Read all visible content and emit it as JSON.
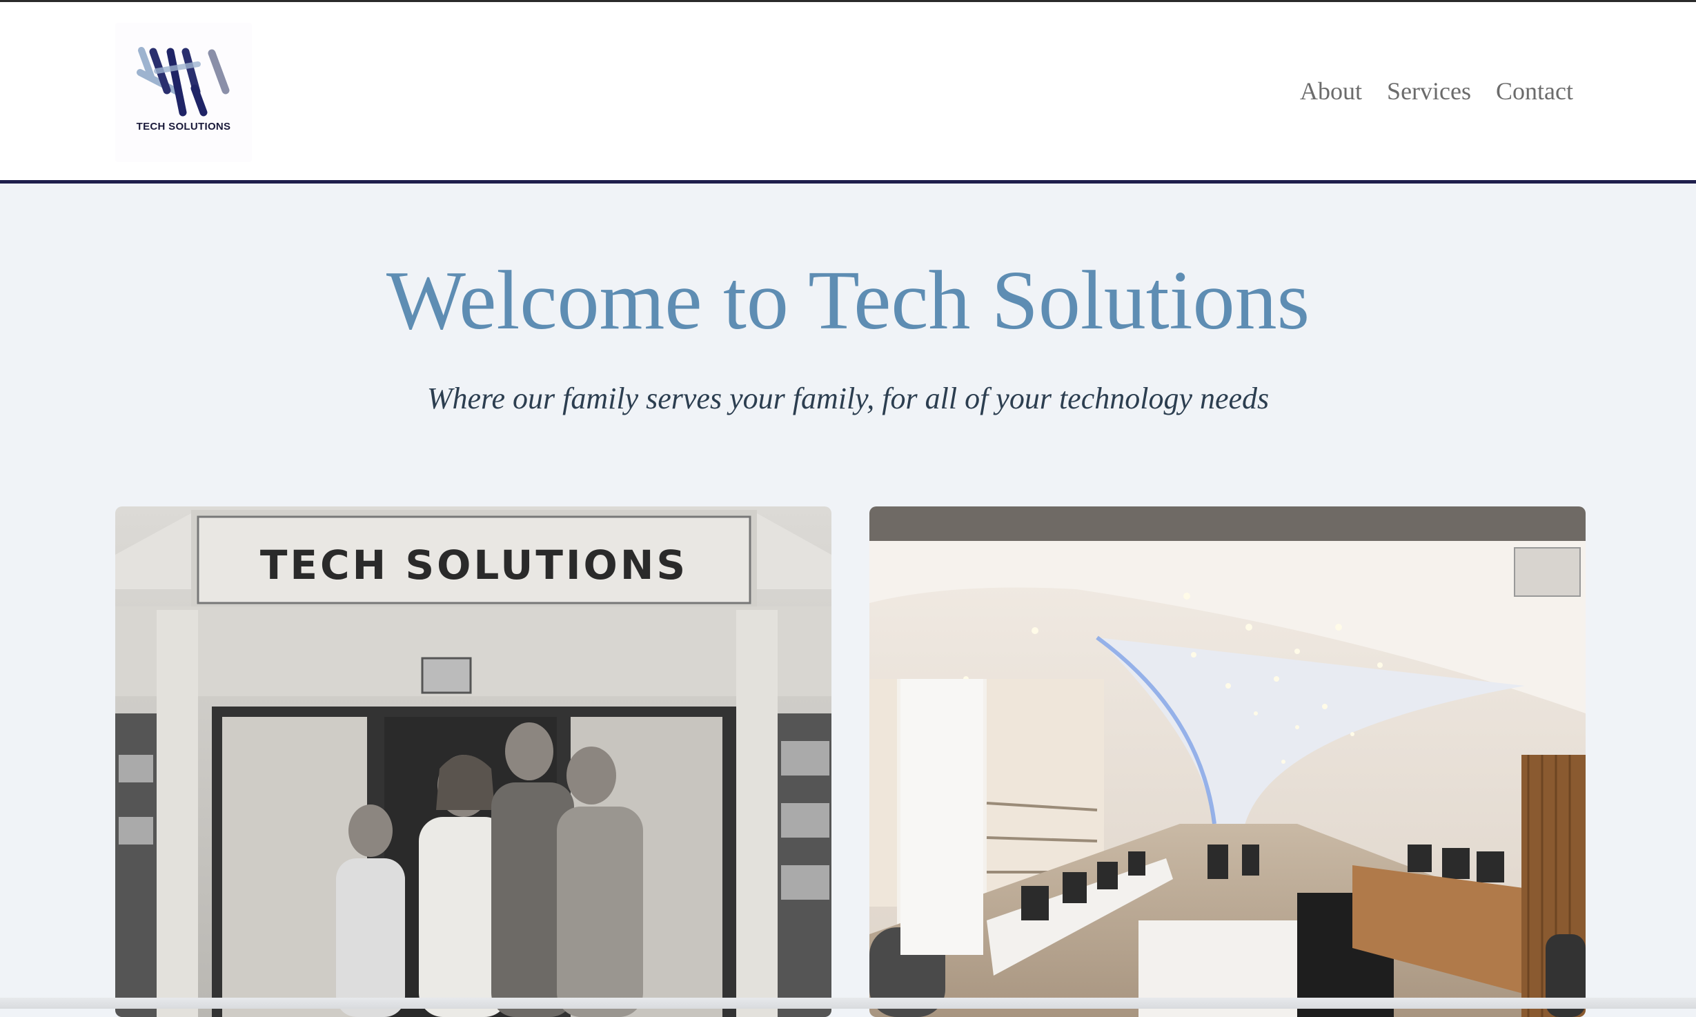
{
  "logo": {
    "text": "TECH SOLUTIONS",
    "icon": "stripes-logo-icon",
    "colors": [
      "#1f2466",
      "#9db3cf",
      "#8a8fa8"
    ]
  },
  "nav": {
    "items": [
      "About",
      "Services",
      "Contact"
    ]
  },
  "hero": {
    "title": "Welcome to Tech Solutions",
    "subtitle": "Where our family serves your family, for all of your technology needs"
  },
  "photos": {
    "left": {
      "sign": "TECH   SOLUTIONS",
      "description_icon": "family-storefront-photo"
    },
    "right": {
      "description_icon": "store-interior-photo"
    }
  },
  "colors": {
    "title": "#5e8db3",
    "subtitle": "#2c3e50",
    "nav": "#6b6b6b",
    "header_border": "#1f1f4d",
    "page_bg": "#f0f3f7"
  }
}
